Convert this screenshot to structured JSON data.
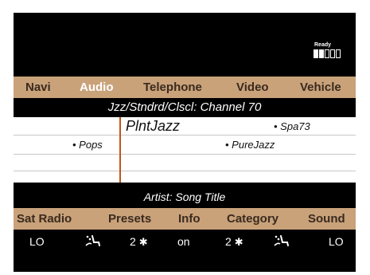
{
  "status": {
    "ready_label": "Ready",
    "bars_filled": 2,
    "bars_total": 5
  },
  "top_tabs": [
    {
      "label": "Navi"
    },
    {
      "label": "Audio"
    },
    {
      "label": "Telephone"
    },
    {
      "label": "Video"
    },
    {
      "label": "Vehicle"
    }
  ],
  "active_top_tab": "Audio",
  "channel_line": "Jzz/Stndrd/Clscl: Channel 70",
  "list": {
    "selected_title": "PlntJazz",
    "selected_right": "• Spa73",
    "row2_left": "• Pops",
    "row2_right": "• PureJazz"
  },
  "artist_line": "Artist: Song Title",
  "bottom_tabs": [
    {
      "label": "Sat Radio"
    },
    {
      "label": "Presets"
    },
    {
      "label": "Info"
    },
    {
      "label": "Category"
    },
    {
      "label": "Sound"
    }
  ],
  "controls": {
    "left_temp": "LO",
    "left_airflow_icon": "seat-airflow-icon",
    "left_fan": "2",
    "fan_icon": "fan-icon",
    "info_state": "on",
    "right_fan": "2",
    "right_airflow_icon": "seat-airflow-icon",
    "right_temp": "LO"
  },
  "colors": {
    "bar_bg": "#c9a27a",
    "active_tab": "#ffffff",
    "divider": "#c0561a"
  }
}
